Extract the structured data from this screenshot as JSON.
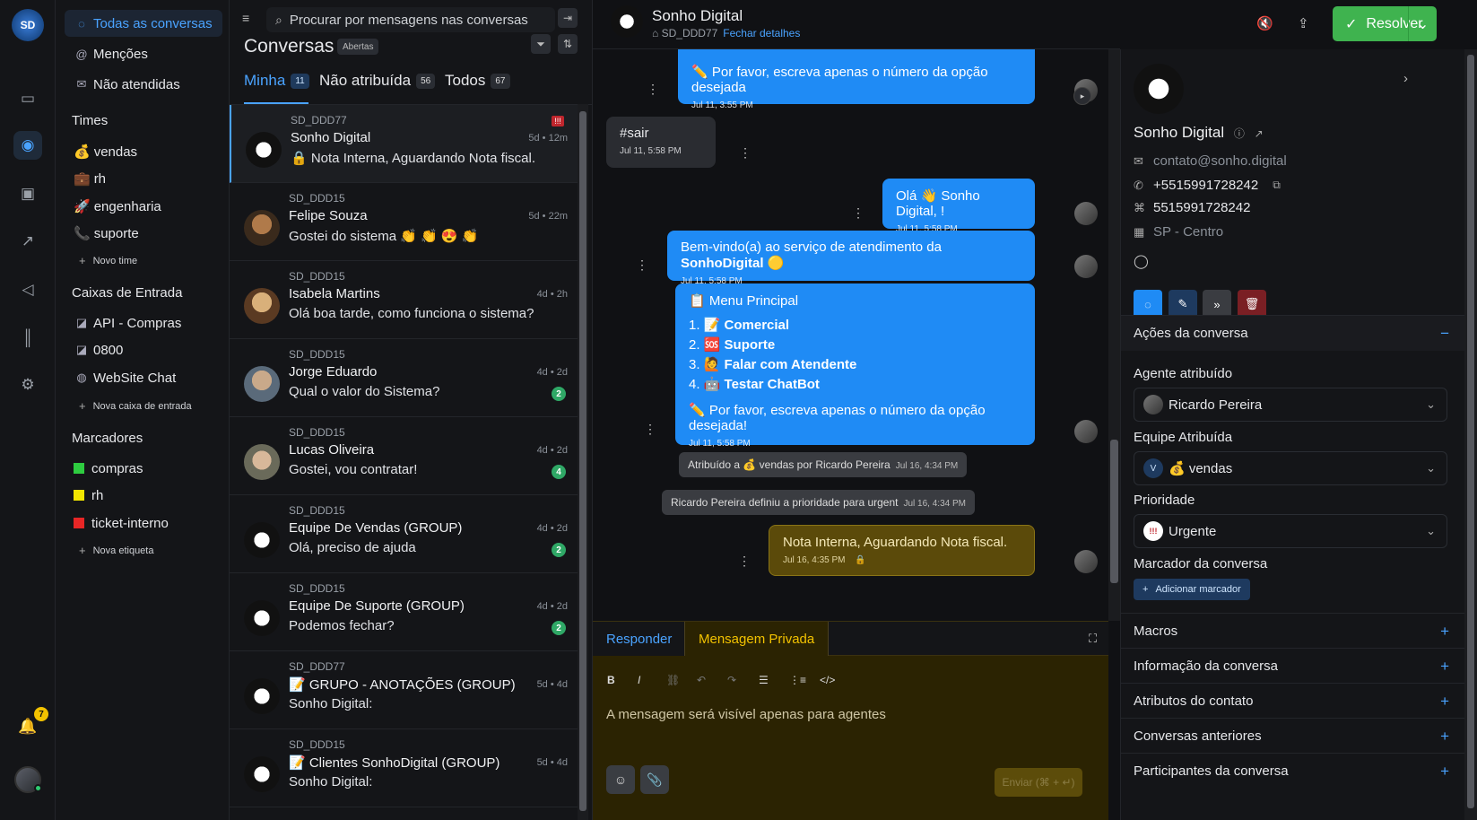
{
  "nav": {
    "bell_badge": "7"
  },
  "sidebar": {
    "items": [
      {
        "label": "Todas as conversas",
        "icon": "chat-icon"
      },
      {
        "label": "Menções",
        "icon": "at-icon"
      },
      {
        "label": "Não atendidas",
        "icon": "unattended-icon"
      }
    ],
    "teams_heading": "Times",
    "teams": [
      {
        "label": "vendas",
        "emoji": "💰"
      },
      {
        "label": "rh",
        "emoji": "💼"
      },
      {
        "label": "engenharia",
        "emoji": "🚀"
      },
      {
        "label": "suporte",
        "emoji": "📞"
      }
    ],
    "new_team": "Novo time",
    "inboxes_heading": "Caixas de Entrada",
    "inboxes": [
      {
        "label": "API - Compras",
        "icon": "api-icon"
      },
      {
        "label": "0800",
        "icon": "phone-icon"
      },
      {
        "label": "WebSite Chat",
        "icon": "web-icon"
      }
    ],
    "new_inbox": "Nova caixa de entrada",
    "labels_heading": "Marcadores",
    "labels": [
      {
        "label": "compras",
        "color": "#2ecc40"
      },
      {
        "label": "rh",
        "color": "#f2e600"
      },
      {
        "label": "ticket-interno",
        "color": "#e82626"
      }
    ],
    "new_label": "Nova etiqueta"
  },
  "convlist": {
    "search_placeholder": "Procurar por mensagens nas conversas",
    "title": "Conversas",
    "status_pill": "Abertas",
    "tabs": [
      {
        "label": "Minha",
        "count": "11"
      },
      {
        "label": "Não atribuída",
        "count": "56"
      },
      {
        "label": "Todos",
        "count": "67"
      }
    ],
    "items": [
      {
        "inbox": "SD_DDD77",
        "name": "Sonho Digital",
        "message": "🔒 Nota Interna, Aguardando Nota fiscal.",
        "time": "5d • 12m",
        "unread": "",
        "priority": true
      },
      {
        "inbox": "SD_DDD15",
        "name": "Felipe Souza",
        "message": "Gostei do sistema 👏 👏 😍 👏",
        "time": "5d • 22m",
        "unread": "",
        "priority": false
      },
      {
        "inbox": "SD_DDD15",
        "name": "Isabela Martins",
        "message": "Olá boa tarde, como funciona o sistema?",
        "time": "4d • 2h",
        "unread": "",
        "priority": false
      },
      {
        "inbox": "SD_DDD15",
        "name": "Jorge Eduardo",
        "message": "Qual o valor do Sistema?",
        "time": "4d • 2d",
        "unread": "2",
        "priority": false
      },
      {
        "inbox": "SD_DDD15",
        "name": "Lucas Oliveira",
        "message": "Gostei, vou contratar!",
        "time": "4d • 2d",
        "unread": "4",
        "priority": false
      },
      {
        "inbox": "SD_DDD15",
        "name": "Equipe De Vendas (GROUP)",
        "message": "Olá, preciso de ajuda",
        "time": "4d • 2d",
        "unread": "2",
        "priority": false
      },
      {
        "inbox": "SD_DDD15",
        "name": "Equipe De Suporte (GROUP)",
        "message": "Podemos fechar?",
        "time": "4d • 2d",
        "unread": "2",
        "priority": false
      },
      {
        "inbox": "SD_DDD77",
        "name": "📝 GRUPO - ANOTAÇÕES (GROUP)",
        "message": "Sonho Digital:",
        "time": "5d • 4d",
        "unread": "",
        "priority": false
      },
      {
        "inbox": "SD_DDD15",
        "name": "📝 Clientes SonhoDigital (GROUP)",
        "message": "Sonho Digital:",
        "time": "5d • 4d",
        "unread": "",
        "priority": false
      }
    ]
  },
  "chat": {
    "name": "Sonho Digital",
    "inbox": "SD_DDD77",
    "close_details": "Fechar detalhes",
    "resolve": "Resolver",
    "messages": {
      "m1_text": "✏️ Por favor, escreva apenas o número da opção desejada",
      "m1_time": "Jul 11, 3:55 PM",
      "m2_text": "#sair",
      "m2_time": "Jul 11, 5:58 PM",
      "m3_text": "Olá 👋 Sonho Digital, !",
      "m3_time": "Jul 11, 5:58 PM",
      "m4_text_a": "Bem-vindo(a) ao serviço de atendimento da ",
      "m4_text_b": "SonhoDigital",
      "m4_emoji": "🟡",
      "m4_time": "Jul 11, 5:58 PM",
      "menu_title": "📋 Menu Principal",
      "menu_items": [
        "📝 Comercial",
        "🆘 Suporte",
        "🙋 Falar com Atendente",
        "🤖 Testar ChatBot"
      ],
      "menu_footer": "✏️ Por favor, escreva apenas o número da opção desejada!",
      "menu_time": "Jul 11, 5:58 PM",
      "act1": "Atribuído a 💰 vendas por Ricardo Pereira",
      "act1_time": "Jul 16, 4:34 PM",
      "act2": "Ricardo Pereira definiu a prioridade para urgent",
      "act2_time": "Jul 16, 4:34 PM",
      "note_text": "Nota Interna, Aguardando Nota fiscal.",
      "note_time": "Jul 16, 4:35 PM"
    },
    "composer": {
      "tab_reply": "Responder",
      "tab_private": "Mensagem Privada",
      "placeholder": "A mensagem será visível apenas para agentes",
      "send": "Enviar (⌘ + ↵)"
    }
  },
  "contact": {
    "name": "Sonho Digital",
    "email": "contato@sonho.digital",
    "phone": "+5515991728242",
    "identifier": "5515991728242",
    "location": "SP - Centro",
    "actions_title": "Ações da conversa",
    "agent_label": "Agente atribuído",
    "agent_value": "Ricardo Pereira",
    "team_label": "Equipe Atribuída",
    "team_value": "💰 vendas",
    "team_initial": "V",
    "priority_label": "Prioridade",
    "priority_value": "Urgente",
    "tag_label": "Marcador da conversa",
    "add_tag": "Adicionar marcador",
    "sections": [
      "Macros",
      "Informação da conversa",
      "Atributos do contato",
      "Conversas anteriores",
      "Participantes da conversa"
    ]
  },
  "colors": {
    "accent": "#4aa3ff",
    "resolve": "#3fb34f",
    "note": "#5b4a0a",
    "outgoing": "#1f8bf5"
  }
}
